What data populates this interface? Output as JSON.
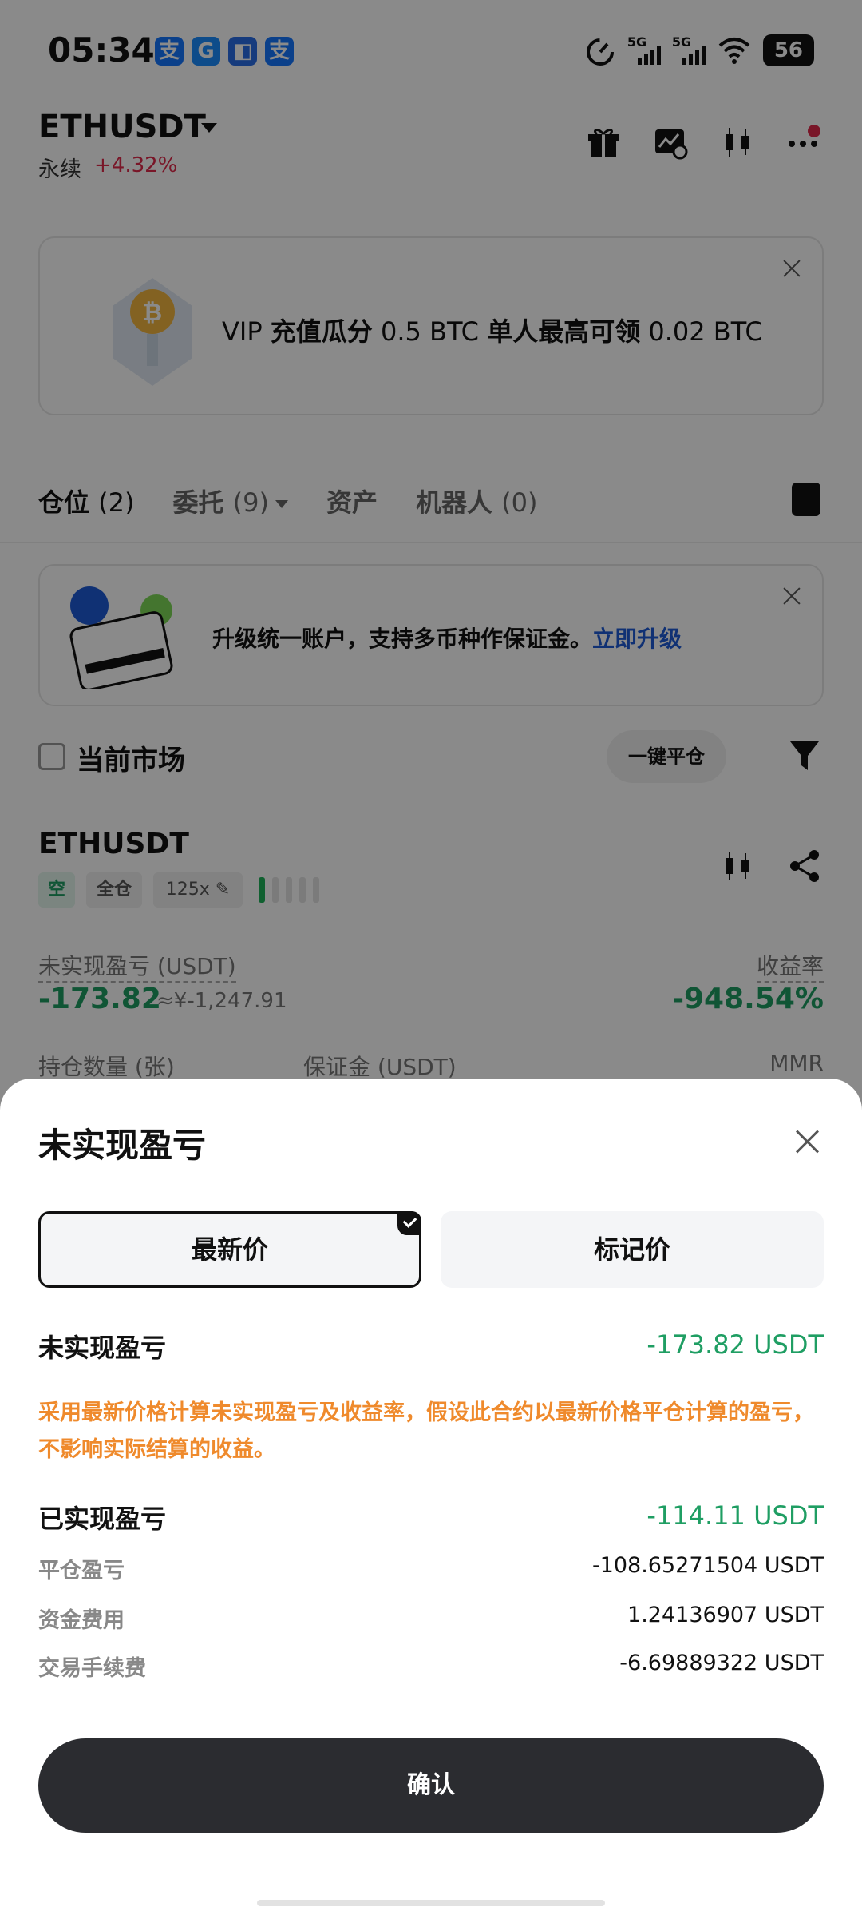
{
  "status_bar": {
    "time": "05:34",
    "app_icons": [
      {
        "glyph": "支",
        "color": "#1677ff",
        "name": "alipay-icon"
      },
      {
        "glyph": "G",
        "color": "#1a8cff",
        "name": "app-icon"
      },
      {
        "glyph": "◧",
        "color": "#2a6ee8",
        "name": "app-icon"
      },
      {
        "glyph": "支",
        "color": "#1677ff",
        "name": "alipay-icon"
      }
    ],
    "signal1": "5G",
    "signal2": "5G",
    "battery": "56"
  },
  "header": {
    "pair": "ETHUSDT",
    "type": "永续",
    "change": "+4.32%"
  },
  "vip_banner": {
    "prefix": "VIP ",
    "bold1": "充值瓜分",
    "mid": " 0.5 BTC ",
    "bold2": "单人最高可领",
    "suffix": " 0.02 BTC"
  },
  "tabs": [
    {
      "label": "仓位",
      "count": "(2)"
    },
    {
      "label": "委托",
      "count": "(9)"
    },
    {
      "label": "资产",
      "count": ""
    },
    {
      "label": "机器人",
      "count": "(0)"
    }
  ],
  "upgrade_banner": {
    "text": "升级统一账户，支持多币种作保证金。",
    "link": "立即升级"
  },
  "filter": {
    "checkbox_label": "当前市场",
    "close_all": "一键平仓"
  },
  "position": {
    "symbol": "ETHUSDT",
    "side": "空",
    "margin_mode": "全仓",
    "leverage": "125x",
    "leverage_level": 1,
    "leverage_levels_total": 5,
    "upnl_label": "未实现盈亏",
    "upnl_unit": "(USDT)",
    "upnl": "-173.82",
    "upnl_cny": "≈¥-1,247.91",
    "roe_label": "收益率",
    "roe": "-948.54%",
    "size_label": "持仓数量",
    "size_unit": "(张)",
    "margin_label": "保证金",
    "margin_unit": "(USDT)",
    "mmr_label": "MMR"
  },
  "sheet": {
    "title": "未实现盈亏",
    "options": [
      "最新价",
      "标记价"
    ],
    "selected_option": "最新价",
    "unrealized_label": "未实现盈亏",
    "unrealized_value": "-173.82 USDT",
    "note": "采用最新价格计算未实现盈亏及收益率，假设此合约以最新价格平仓计算的盈亏，不影响实际结算的收益。",
    "realized_label": "已实现盈亏",
    "realized_value": "-114.11 USDT",
    "details": [
      {
        "label": "平仓盈亏",
        "value": "-108.65271504 USDT"
      },
      {
        "label": "资金费用",
        "value": "1.24136907 USDT"
      },
      {
        "label": "交易手续费",
        "value": "-6.69889322 USDT"
      }
    ],
    "confirm": "确认"
  },
  "colors": {
    "positive_green": "#1f9e63",
    "negative_red": "#e0294a",
    "note_orange": "#ef8a2c",
    "link_blue": "#1f5cd6",
    "confirm_bg": "#2b2c30"
  }
}
